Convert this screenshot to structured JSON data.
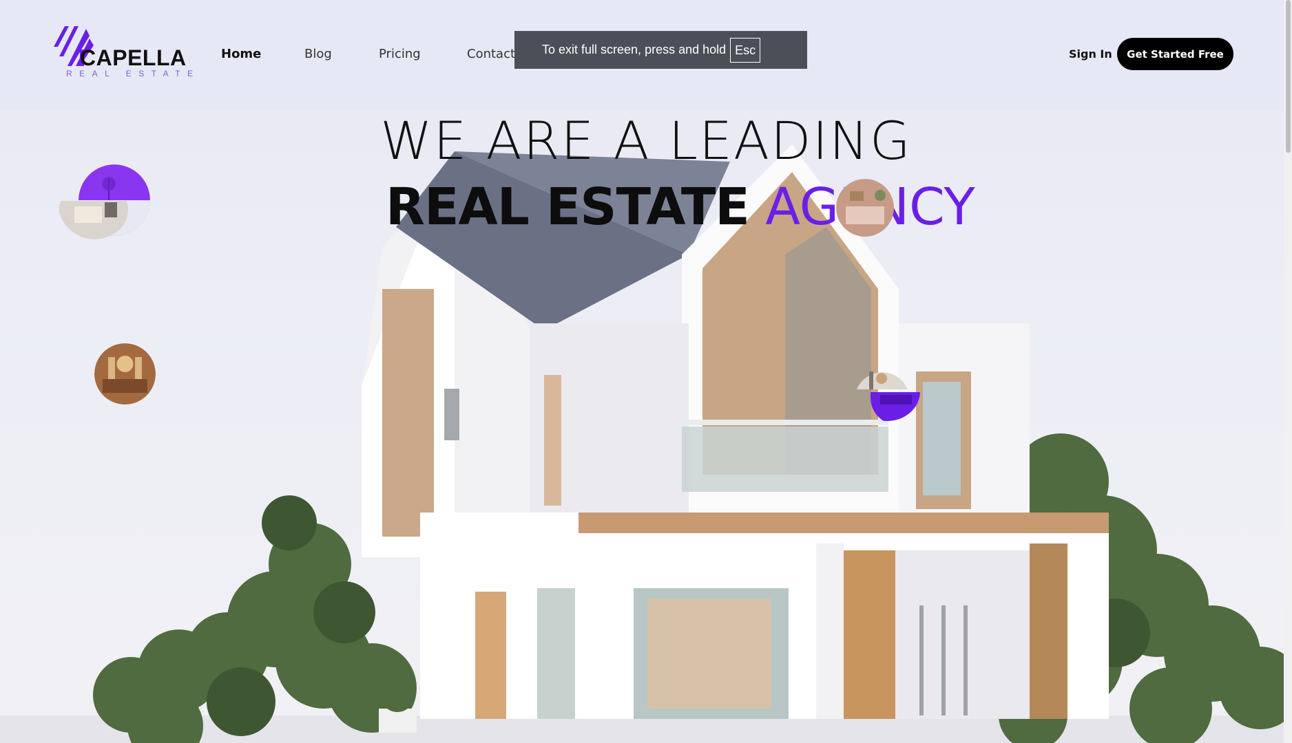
{
  "brand": {
    "name": "CAPELLA",
    "tagline": "REAL ESTATE",
    "logo_icon": "stripes-house-icon",
    "accent_color": "#6b1fe6"
  },
  "nav": {
    "items": [
      {
        "label": "Home",
        "active": true
      },
      {
        "label": "Blog",
        "active": false
      },
      {
        "label": "Pricing",
        "active": false
      },
      {
        "label": "Contact",
        "active": false
      }
    ],
    "sign_in": "Sign In",
    "cta": "Get Started Free"
  },
  "fullscreen_toast": {
    "message": "To exit full screen, press and hold",
    "key": "Esc"
  },
  "hero": {
    "line1": "WE ARE A LEADING",
    "line2_bold": "REAL ESTATE",
    "line2_accent": "AGENCY"
  }
}
